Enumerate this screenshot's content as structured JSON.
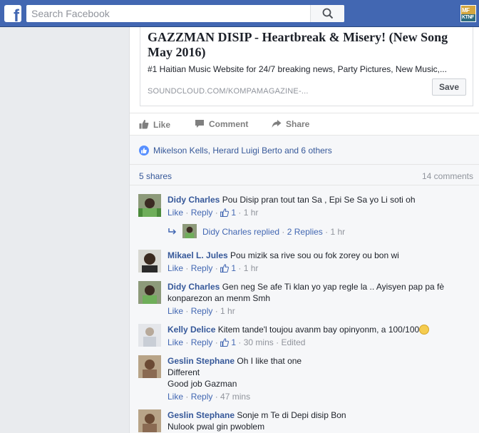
{
  "topbar": {
    "logo": "f",
    "search_placeholder": "Search Facebook",
    "avatar_text_top": "MF",
    "avatar_text_bottom": "KTNF"
  },
  "link_preview": {
    "title": "GAZZMAN DISIP - Heartbreak & Misery! (New Song May 2016)",
    "description": "#1 Haitian Music Website for 24/7 breaking news, Party Pictures, New Music,...",
    "domain": "SOUNDCLOUD.COM/KOMPAMAGAZINE-...",
    "save_label": "Save"
  },
  "actions": {
    "like": "Like",
    "comment": "Comment",
    "share": "Share"
  },
  "likes": {
    "text": "Mikelson Kells, Herard Luigi Berto and 6 others"
  },
  "stats": {
    "shares": "5 shares",
    "comments": "14 comments"
  },
  "comments": [
    {
      "name": "Didy Charles",
      "text": "Pou Disip pran tout tan Sa , Epi Se Sa yo Li soti oh",
      "like": "Like",
      "reply": "Reply",
      "likes": "1",
      "time": "1 hr",
      "edited": "",
      "replied": {
        "name": "Didy Charles",
        "action": "replied",
        "count": "2 Replies",
        "time": "1 hr"
      }
    },
    {
      "name": "Mikael L. Jules",
      "text": "Pou mizik sa rive sou ou fok zorey ou bon wi",
      "like": "Like",
      "reply": "Reply",
      "likes": "1",
      "time": "1 hr",
      "edited": ""
    },
    {
      "name": "Didy Charles",
      "text": "Gen neg Se afe Ti klan yo yap regle la .. Ayisyen pap pa fè konparezon an menm Smh",
      "like": "Like",
      "reply": "Reply",
      "likes": "",
      "time": "1 hr",
      "edited": ""
    },
    {
      "name": "Kelly Delice",
      "text": "Kitem tande'l toujou avanm bay opinyonm, a 100/100",
      "like": "Like",
      "reply": "Reply",
      "likes": "1",
      "time": "30 mins",
      "edited": "Edited"
    },
    {
      "name": "Geslin Stephane",
      "text": "Oh I like that one",
      "line2": "Different",
      "line3": "Good job Gazman",
      "like": "Like",
      "reply": "Reply",
      "likes": "",
      "time": "47 mins",
      "edited": ""
    },
    {
      "name": "Geslin Stephane",
      "text": "Sonje m Te di Depi disip Bon",
      "line2": "Nulook pwal gin pwoblem",
      "like": "",
      "reply": "",
      "likes": "",
      "time": "",
      "edited": ""
    }
  ],
  "colors": {
    "brand_blue": "#4267b2",
    "link_blue": "#365899",
    "meta_gray": "#90949c"
  }
}
